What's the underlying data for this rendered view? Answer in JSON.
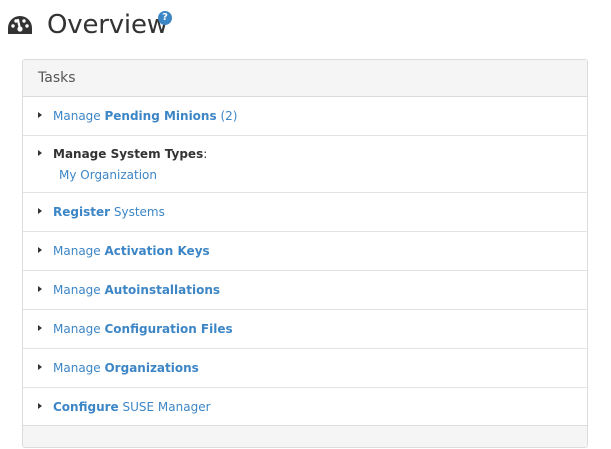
{
  "header": {
    "title": "Overview",
    "help_label": "?"
  },
  "panel": {
    "heading": "Tasks",
    "tasks": [
      {
        "prefix": "Manage ",
        "bold": "Pending Minions",
        "suffix": " (2)"
      },
      {
        "bold": "Manage System Types",
        "suffix": ":",
        "sub": "My Organization"
      },
      {
        "prefix": "",
        "bold": "Register",
        "suffix": " Systems"
      },
      {
        "prefix": "Manage ",
        "bold": "Activation Keys",
        "suffix": ""
      },
      {
        "prefix": "Manage ",
        "bold": "Autoinstallations",
        "suffix": ""
      },
      {
        "prefix": "Manage ",
        "bold": "Configuration Files",
        "suffix": ""
      },
      {
        "prefix": "Manage ",
        "bold": "Organizations",
        "suffix": ""
      },
      {
        "prefix": "",
        "bold": "Configure",
        "suffix": " SUSE Manager"
      }
    ]
  },
  "colors": {
    "link": "#3d86c6",
    "text": "#333333",
    "panel_bg": "#f5f5f5"
  },
  "icons": {
    "title_icon": "gauge-icon",
    "help_icon": "question-circle-icon",
    "row_icon": "caret-right-icon"
  }
}
